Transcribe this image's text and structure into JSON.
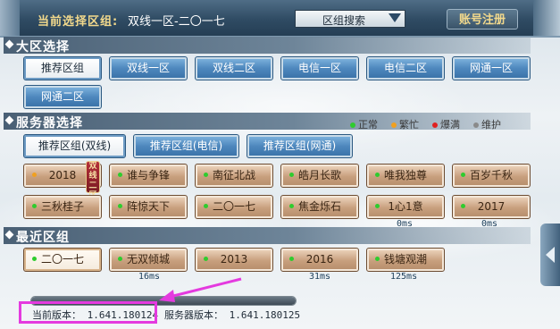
{
  "header": {
    "current_label": "当前选择区组:",
    "current_value": "双线一区-二〇一七",
    "search_select": "区组搜索",
    "account_button": "账号注册"
  },
  "regions": {
    "title": "大区选择",
    "items": [
      "推荐区组",
      "双线一区",
      "双线二区",
      "电信一区",
      "电信二区",
      "网通一区",
      "网通二区"
    ],
    "selected": "推荐区组"
  },
  "servers": {
    "title": "服务器选择",
    "legend": [
      {
        "label": "正常",
        "color": "#2ecc2e"
      },
      {
        "label": "繁忙",
        "color": "#f0a020"
      },
      {
        "label": "爆满",
        "color": "#e02020"
      },
      {
        "label": "维护",
        "color": "#8a8a8a"
      }
    ],
    "groups": [
      "推荐区组(双线)",
      "推荐区组(电信)",
      "推荐区组(网通)"
    ],
    "badge_text": "双线二区",
    "list": [
      {
        "name": "2018",
        "status": "busy",
        "ping": ""
      },
      {
        "name": "谁与争锋",
        "status": "normal",
        "ping": ""
      },
      {
        "name": "南征北战",
        "status": "normal",
        "ping": ""
      },
      {
        "name": "皓月长歌",
        "status": "normal",
        "ping": ""
      },
      {
        "name": "唯我独尊",
        "status": "normal",
        "ping": ""
      },
      {
        "name": "百岁千秋",
        "status": "normal",
        "ping": ""
      },
      {
        "name": "三秋桂子",
        "status": "normal",
        "ping": ""
      },
      {
        "name": "阵惊天下",
        "status": "normal",
        "ping": ""
      },
      {
        "name": "二〇一七",
        "status": "normal",
        "ping": ""
      },
      {
        "name": "焦金烁石",
        "status": "normal",
        "ping": ""
      },
      {
        "name": "1心1意",
        "status": "normal",
        "ping": "0ms"
      },
      {
        "name": "2017",
        "status": "normal",
        "ping": "0ms"
      }
    ]
  },
  "recent": {
    "title": "最近区组",
    "list": [
      {
        "name": "二〇一七",
        "ping": ""
      },
      {
        "name": "无双倾城",
        "ping": "16ms"
      },
      {
        "name": "2013",
        "ping": ""
      },
      {
        "name": "2016",
        "ping": "31ms"
      },
      {
        "name": "钱塘观潮",
        "ping": "125ms"
      }
    ]
  },
  "footer": {
    "progress": 1.0,
    "current_version": "当前版本： 1.641.180124",
    "server_version": "服务器版本： 1.641.180125"
  }
}
